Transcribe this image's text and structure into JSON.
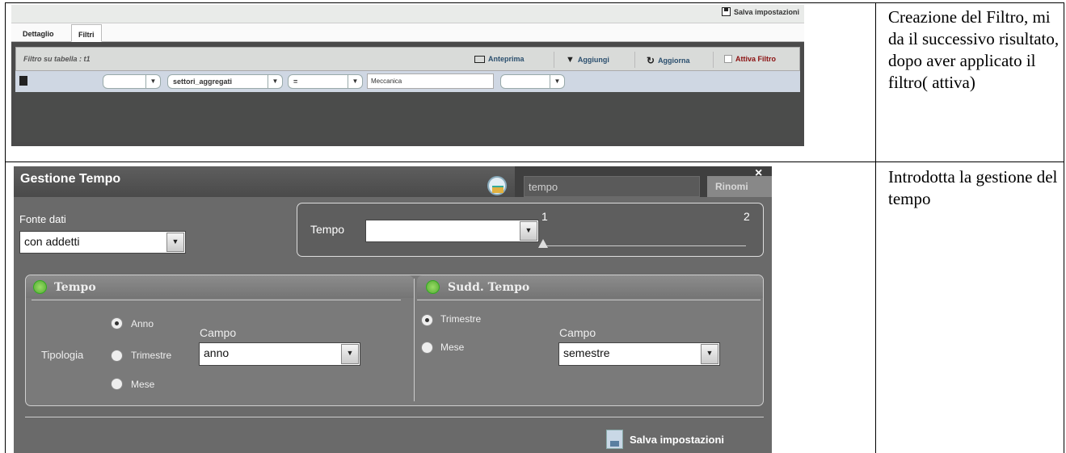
{
  "table": {
    "rows": [
      {
        "note": "Creazione del Filtro, mi da il successivo risultato, dopo aver applicato il filtro( attiva)"
      },
      {
        "note": "Introdotta la gestione del tempo"
      }
    ]
  },
  "filtri_screen": {
    "save_label": "Salva impostazioni",
    "tabs": [
      "Dettaglio",
      "Filtri"
    ],
    "panel_title": "Filtro su tabella : t1",
    "toolbar": {
      "anteprima": "Anteprima",
      "aggiungi": "Aggiungi",
      "aggiorna": "Aggiorna",
      "attiva": "Attiva Filtro"
    },
    "filter_row": {
      "field1": "",
      "field2": "settori_aggregati",
      "operator": "=",
      "value": "Meccanica",
      "field5": ""
    }
  },
  "tempo_screen": {
    "title": "Gestione Tempo",
    "search_value": "tempo",
    "rename_label": "Rinomi",
    "close_icon": "×",
    "fonte_label": "Fonte dati",
    "fonte_value": "con addetti",
    "tempo_label": "Tempo",
    "tempo_value": "",
    "slider_min": "1",
    "slider_max": "2",
    "group_left_title": "Tempo",
    "group_right_title": "Sudd. Tempo",
    "tipologia_label": "Tipologia",
    "radios_left": [
      "Anno",
      "Trimestre",
      "Mese"
    ],
    "campo_label": "Campo",
    "campo_left_value": "anno",
    "radios_right": [
      "Trimestre",
      "Mese"
    ],
    "campo_right_value": "semestre",
    "save_label": "Salva impostazioni"
  }
}
